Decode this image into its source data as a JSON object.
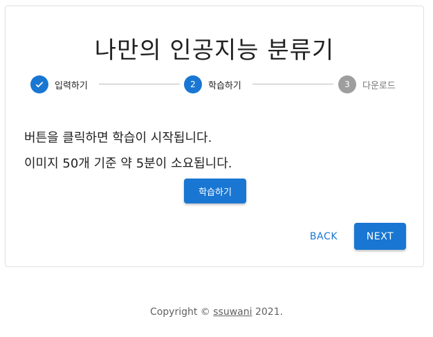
{
  "page": {
    "title": "나만의 인공지능 분류기"
  },
  "stepper": {
    "steps": [
      {
        "number": "",
        "label": "입력하기",
        "state": "completed"
      },
      {
        "number": "2",
        "label": "학습하기",
        "state": "active"
      },
      {
        "number": "3",
        "label": "다운로드",
        "state": "inactive"
      }
    ]
  },
  "content": {
    "line1": "버튼을 클릭하면 학습이 시작됩니다.",
    "line2": "이미지 50개 기준 약 5분이 소요됩니다.",
    "train_button": "학습하기"
  },
  "nav": {
    "back_label": "BACK",
    "next_label": "NEXT"
  },
  "footer": {
    "prefix": "Copyright © ",
    "link_text": "ssuwani",
    "suffix": " 2021."
  },
  "colors": {
    "primary": "#1976d2",
    "inactive": "#9e9e9e"
  }
}
